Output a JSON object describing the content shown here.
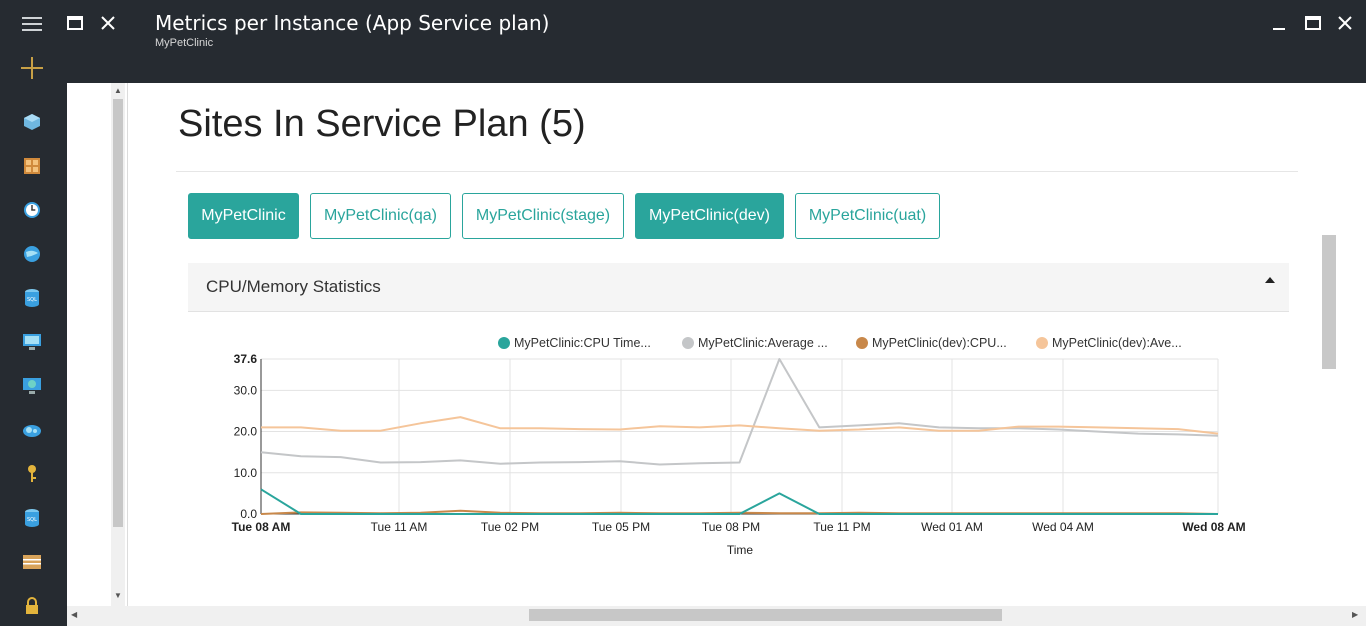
{
  "window": {
    "title": "Metrics per Instance (App Service plan)",
    "subtitle": "MyPetClinic"
  },
  "page": {
    "heading": "Sites In Service Plan (5)"
  },
  "sites": [
    {
      "label": "MyPetClinic",
      "active": true
    },
    {
      "label": "MyPetClinic(qa)",
      "active": false
    },
    {
      "label": "MyPetClinic(stage)",
      "active": false
    },
    {
      "label": "MyPetClinic(dev)",
      "active": true
    },
    {
      "label": "MyPetClinic(uat)",
      "active": false
    }
  ],
  "panel": {
    "title": "CPU/Memory Statistics"
  },
  "colors": {
    "accent": "#2aa59c",
    "chrome": "#262b31"
  },
  "chart_data": {
    "type": "line",
    "xlabel": "Time",
    "ylabel": "",
    "ylim": [
      0,
      37.6
    ],
    "yticks": [
      "0.0",
      "10.0",
      "20.0",
      "30.0",
      "37.6"
    ],
    "xticks": [
      "Tue 08 AM",
      "Tue 11 AM",
      "Tue 02 PM",
      "Tue 05 PM",
      "Tue 08 PM",
      "Tue 11 PM",
      "Wed 01 AM",
      "Wed 04 AM",
      "Wed 08 AM"
    ],
    "grid": true,
    "legend_position": "top",
    "x": [
      "Tue 08 AM",
      "Tue 09 AM",
      "Tue 10 AM",
      "Tue 11 AM",
      "Tue 12 PM",
      "Tue 01 PM",
      "Tue 02 PM",
      "Tue 03 PM",
      "Tue 04 PM",
      "Tue 05 PM",
      "Tue 06 PM",
      "Tue 07 PM",
      "Tue 08 PM",
      "Tue 09 PM",
      "Tue 10 PM",
      "Tue 11 PM",
      "Wed 12 AM",
      "Wed 01 AM",
      "Wed 02 AM",
      "Wed 03 AM",
      "Wed 04 AM",
      "Wed 05 AM",
      "Wed 06 AM",
      "Wed 07 AM",
      "Wed 08 AM"
    ],
    "series": [
      {
        "name": "MyPetClinic:CPU Time...",
        "color": "#2aa59c",
        "values": [
          6,
          0,
          0,
          0,
          0,
          0,
          0,
          0,
          0,
          0,
          0,
          0,
          0,
          5,
          0,
          0,
          0,
          0,
          0,
          0,
          0,
          0,
          0,
          0,
          0
        ]
      },
      {
        "name": "MyPetClinic:Average ...",
        "color": "#c4c6c8",
        "values": [
          15,
          14,
          13.8,
          12.5,
          12.6,
          13,
          12.2,
          12.5,
          12.6,
          12.8,
          12,
          12.3,
          12.5,
          37.6,
          21,
          21.5,
          22,
          21,
          20.8,
          20.8,
          20.5,
          20,
          19.5,
          19.3,
          19
        ]
      },
      {
        "name": "MyPetClinic(dev):CPU...",
        "color": "#c8884a",
        "values": [
          0,
          0.4,
          0.3,
          0.2,
          0.3,
          0.8,
          0.3,
          0.2,
          0.2,
          0.3,
          0.2,
          0.2,
          0.3,
          0.2,
          0.2,
          0.3,
          0.2,
          0.2,
          0.2,
          0.2,
          0.2,
          0.2,
          0.2,
          0.2,
          0
        ]
      },
      {
        "name": "MyPetClinic(dev):Ave...",
        "color": "#f5c59a",
        "values": [
          21,
          21,
          20.2,
          20.2,
          22,
          23.5,
          20.8,
          20.8,
          20.6,
          20.5,
          21.3,
          21,
          21.5,
          20.8,
          20.2,
          20.5,
          21,
          20.2,
          20.2,
          21.2,
          21.2,
          21,
          20.8,
          20.6,
          19.5
        ]
      }
    ]
  }
}
